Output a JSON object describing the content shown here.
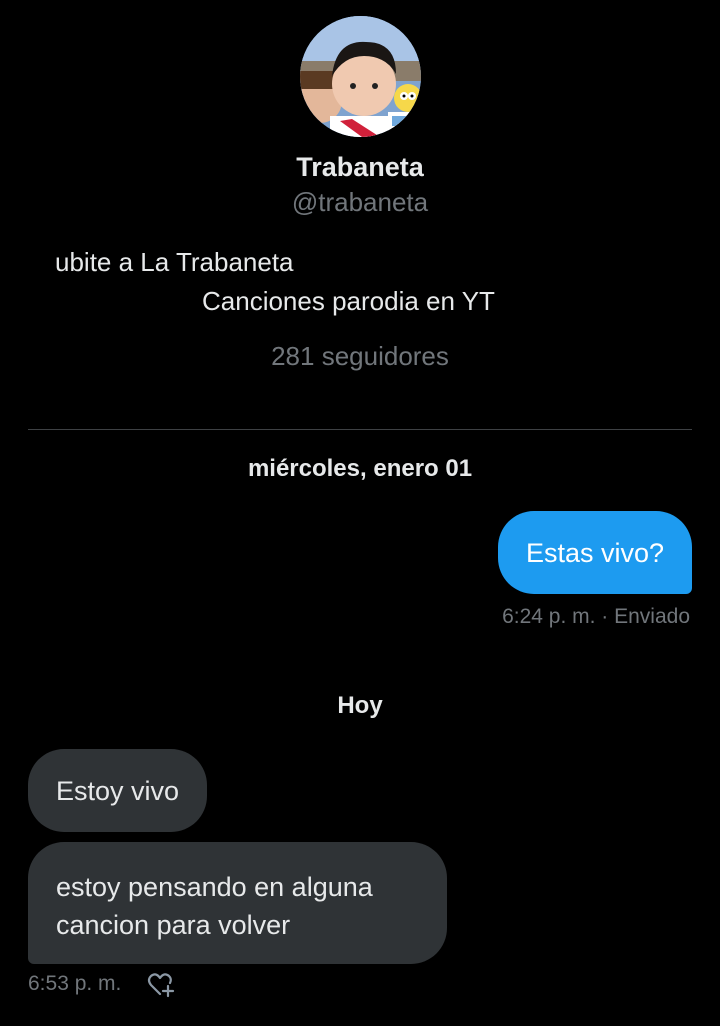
{
  "profile": {
    "name": "Trabaneta",
    "handle": "@trabaneta",
    "bio_line1": "ubite a La Trabaneta",
    "bio_line2": "Canciones parodia en YT",
    "followers": "281 seguidores"
  },
  "conversation": {
    "date_separator_1": "miércoles, enero 01",
    "sent_message": {
      "text": "Estas vivo?",
      "meta": "6:24 p. m. · Enviado"
    },
    "date_separator_2": "Hoy",
    "received_messages": [
      {
        "text": "Estoy vivo"
      },
      {
        "text": "estoy pensando en alguna cancion para volver"
      }
    ],
    "received_meta": "6:53 p. m."
  },
  "colors": {
    "background": "#000000",
    "sent_bubble": "#1d9bf0",
    "received_bubble": "#2f3336",
    "muted_text": "#71767b",
    "primary_text": "#e7e9ea"
  },
  "icons": {
    "reaction": "heart-add-icon"
  }
}
